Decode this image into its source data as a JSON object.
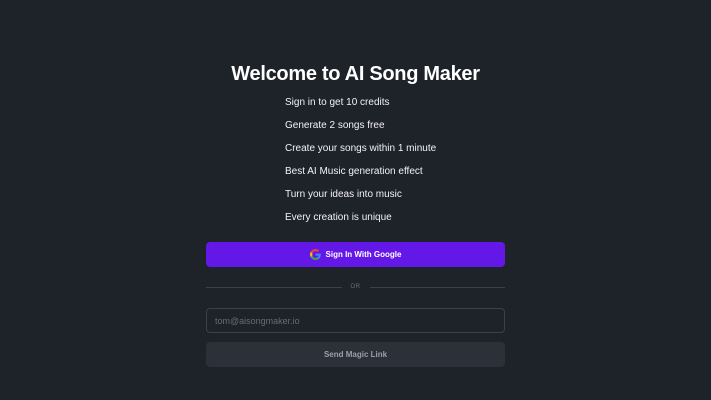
{
  "header": {
    "title": "Welcome to AI Song Maker"
  },
  "benefits": [
    "Sign in to get 10 credits",
    "Generate 2 songs free",
    "Create your songs within 1 minute",
    "Best AI Music generation effect",
    "Turn your ideas into music",
    "Every creation is unique"
  ],
  "google_signin": {
    "label": "Sign In With Google",
    "icon": "google-g-icon"
  },
  "divider": {
    "label": "OR"
  },
  "email": {
    "placeholder": "tom@aisongmaker.io",
    "value": ""
  },
  "magic_link": {
    "label": "Send Magic Link"
  },
  "colors": {
    "background": "#1e2229",
    "primary_button": "#6418e8",
    "secondary_button": "#2b3039",
    "input_border": "#3b404a"
  }
}
